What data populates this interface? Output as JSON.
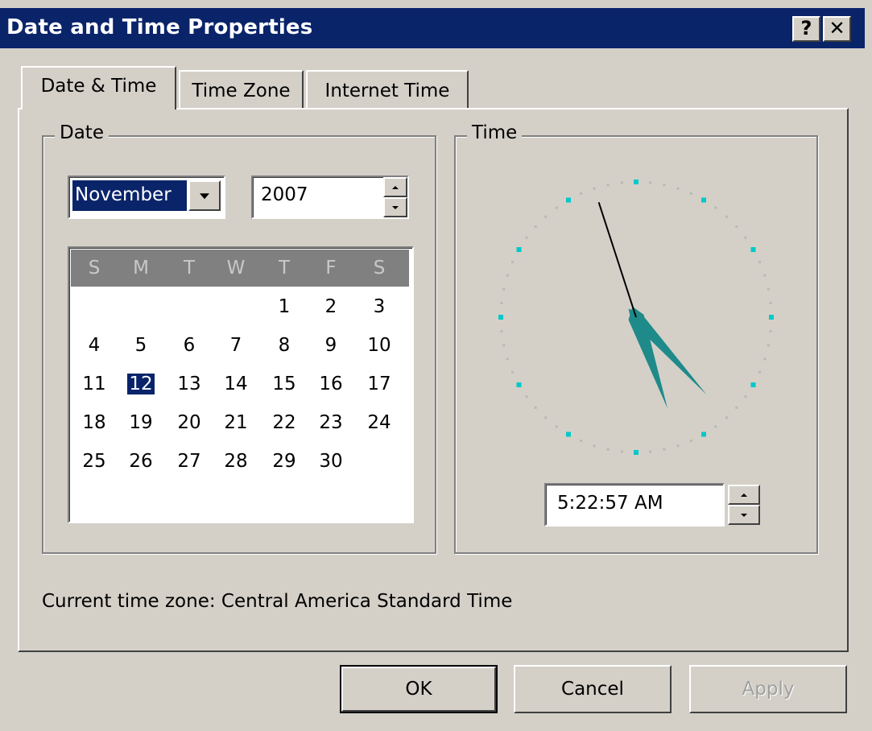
{
  "window": {
    "title": "Date and Time Properties",
    "help_label": "?",
    "close_label": "✕"
  },
  "tabs": [
    {
      "label": "Date & Time",
      "active": true
    },
    {
      "label": "Time Zone",
      "active": false
    },
    {
      "label": "Internet Time",
      "active": false
    }
  ],
  "date_group": {
    "label": "Date",
    "month": "November",
    "year": "2007",
    "weekdays": [
      "S",
      "M",
      "T",
      "W",
      "T",
      "F",
      "S"
    ],
    "weeks": [
      [
        "",
        "",
        "",
        "",
        "1",
        "2",
        "3"
      ],
      [
        "4",
        "5",
        "6",
        "7",
        "8",
        "9",
        "10"
      ],
      [
        "11",
        "12",
        "13",
        "14",
        "15",
        "16",
        "17"
      ],
      [
        "18",
        "19",
        "20",
        "21",
        "22",
        "23",
        "24"
      ],
      [
        "25",
        "26",
        "27",
        "28",
        "29",
        "30",
        ""
      ]
    ],
    "selected_day": "12"
  },
  "time_group": {
    "label": "Time",
    "time_value": "5:22:57 AM",
    "clock": {
      "hour": 5,
      "minute": 22,
      "second": 57
    }
  },
  "timezone_text": "Current time zone:  Central America Standard Time",
  "buttons": {
    "ok": "OK",
    "cancel": "Cancel",
    "apply": "Apply"
  },
  "colors": {
    "title_bar": "#0a246a",
    "face": "#d4d0c8",
    "clock_hand": "#1f8a8a",
    "clock_tick": "#00c8c8"
  }
}
